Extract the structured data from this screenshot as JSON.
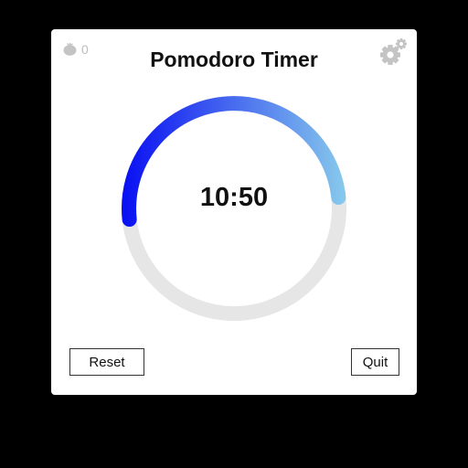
{
  "header": {
    "title": "Pomodoro Timer",
    "completed_count": "0",
    "counter_icon": "tomato-icon",
    "settings_icon": "gears-icon"
  },
  "timer": {
    "display": "10:50",
    "progress_fraction": 0.5
  },
  "actions": {
    "reset_label": "Reset",
    "quit_label": "Quit"
  },
  "colors": {
    "background": "#000000",
    "panel": "#ffffff",
    "track": "#e6e6e6",
    "progress_start": "#0a10f2",
    "progress_end": "#86c8ec",
    "icon_gray": "#c4c4c4"
  }
}
